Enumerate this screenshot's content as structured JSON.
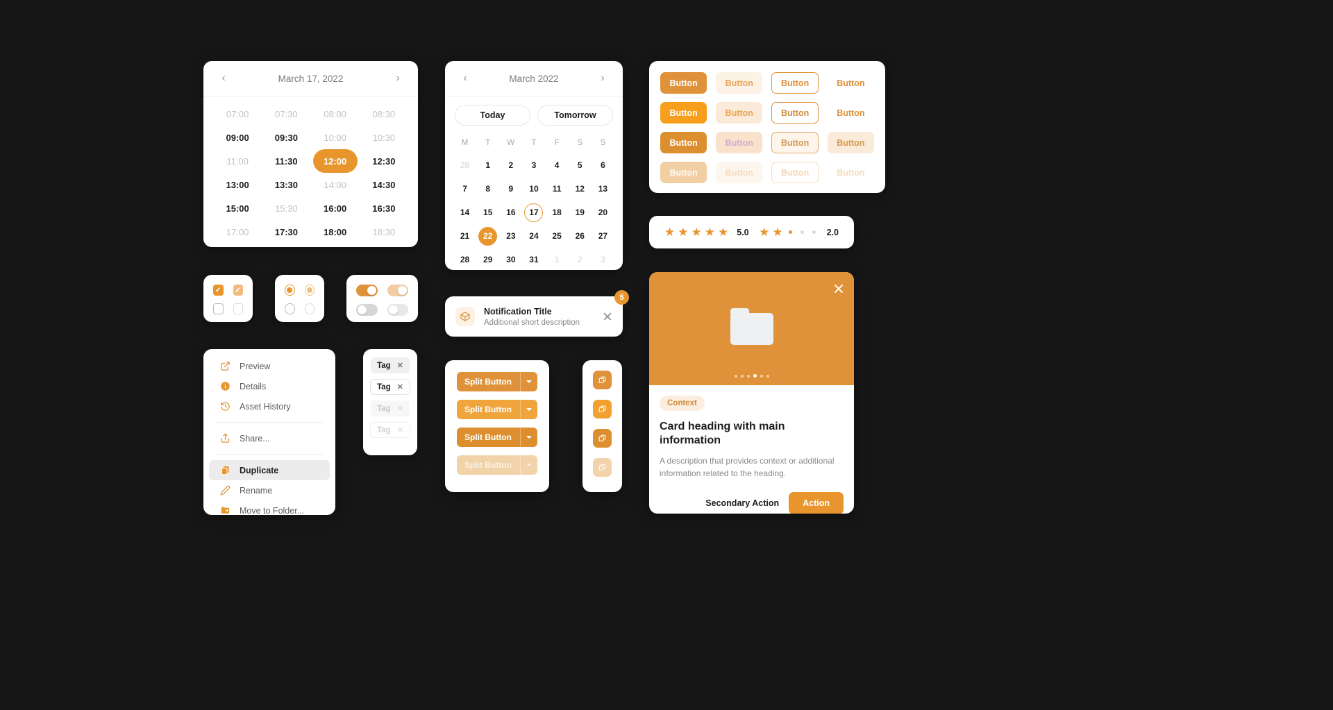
{
  "time_picker": {
    "title": "March 17, 2022",
    "prev_icon": "chevron-left-icon",
    "next_icon": "chevron-right-icon",
    "slots": [
      {
        "label": "07:00",
        "state": "disabled"
      },
      {
        "label": "07:30",
        "state": "disabled"
      },
      {
        "label": "08:00",
        "state": "disabled"
      },
      {
        "label": "08:30",
        "state": "disabled"
      },
      {
        "label": "09:00",
        "state": "available"
      },
      {
        "label": "09:30",
        "state": "available"
      },
      {
        "label": "10:00",
        "state": "disabled"
      },
      {
        "label": "10:30",
        "state": "disabled"
      },
      {
        "label": "11:00",
        "state": "disabled"
      },
      {
        "label": "11:30",
        "state": "available"
      },
      {
        "label": "12:00",
        "state": "selected"
      },
      {
        "label": "12:30",
        "state": "available"
      },
      {
        "label": "13:00",
        "state": "available"
      },
      {
        "label": "13:30",
        "state": "available"
      },
      {
        "label": "14:00",
        "state": "disabled"
      },
      {
        "label": "14:30",
        "state": "available"
      },
      {
        "label": "15:00",
        "state": "available"
      },
      {
        "label": "15:30",
        "state": "disabled"
      },
      {
        "label": "16:00",
        "state": "available"
      },
      {
        "label": "16:30",
        "state": "available"
      },
      {
        "label": "17:00",
        "state": "disabled"
      },
      {
        "label": "17:30",
        "state": "available"
      },
      {
        "label": "18:00",
        "state": "available"
      },
      {
        "label": "18:30",
        "state": "disabled"
      }
    ]
  },
  "calendar": {
    "title": "March 2022",
    "prev_icon": "chevron-left-icon",
    "next_icon": "chevron-right-icon",
    "quick": [
      {
        "label": "Today"
      },
      {
        "label": "Tomorrow"
      }
    ],
    "dow": [
      "M",
      "T",
      "W",
      "T",
      "F",
      "S",
      "S"
    ],
    "days": [
      {
        "n": "28",
        "state": "outside"
      },
      {
        "n": "1",
        "state": "normal"
      },
      {
        "n": "2",
        "state": "normal"
      },
      {
        "n": "3",
        "state": "normal"
      },
      {
        "n": "4",
        "state": "normal"
      },
      {
        "n": "5",
        "state": "normal"
      },
      {
        "n": "6",
        "state": "normal"
      },
      {
        "n": "7",
        "state": "normal"
      },
      {
        "n": "8",
        "state": "normal"
      },
      {
        "n": "9",
        "state": "normal"
      },
      {
        "n": "10",
        "state": "normal"
      },
      {
        "n": "11",
        "state": "normal"
      },
      {
        "n": "12",
        "state": "normal"
      },
      {
        "n": "13",
        "state": "normal"
      },
      {
        "n": "14",
        "state": "normal"
      },
      {
        "n": "15",
        "state": "normal"
      },
      {
        "n": "16",
        "state": "normal"
      },
      {
        "n": "17",
        "state": "today"
      },
      {
        "n": "18",
        "state": "normal"
      },
      {
        "n": "19",
        "state": "normal"
      },
      {
        "n": "20",
        "state": "normal"
      },
      {
        "n": "21",
        "state": "normal"
      },
      {
        "n": "22",
        "state": "selected"
      },
      {
        "n": "23",
        "state": "normal"
      },
      {
        "n": "24",
        "state": "normal"
      },
      {
        "n": "25",
        "state": "normal"
      },
      {
        "n": "26",
        "state": "normal"
      },
      {
        "n": "27",
        "state": "normal"
      },
      {
        "n": "28",
        "state": "normal"
      },
      {
        "n": "29",
        "state": "normal"
      },
      {
        "n": "30",
        "state": "normal"
      },
      {
        "n": "31",
        "state": "normal"
      },
      {
        "n": "1",
        "state": "outside"
      },
      {
        "n": "2",
        "state": "outside"
      },
      {
        "n": "3",
        "state": "outside"
      }
    ]
  },
  "button_matrix": {
    "rows": [
      [
        {
          "label": "Button",
          "variant": "fill"
        },
        {
          "label": "Button",
          "variant": "tint"
        },
        {
          "label": "Button",
          "variant": "outline"
        },
        {
          "label": "Button",
          "variant": "ghost"
        }
      ],
      [
        {
          "label": "Button",
          "variant": "fill2"
        },
        {
          "label": "Button",
          "variant": "tint2"
        },
        {
          "label": "Button",
          "variant": "outline2"
        },
        {
          "label": "Button",
          "variant": "ghost2"
        }
      ],
      [
        {
          "label": "Button",
          "variant": "fill3"
        },
        {
          "label": "Button",
          "variant": "tint3"
        },
        {
          "label": "Button",
          "variant": "outline3"
        },
        {
          "label": "Button",
          "variant": "ghost3"
        }
      ],
      [
        {
          "label": "Button",
          "variant": "filldis"
        },
        {
          "label": "Button",
          "variant": "tintdis"
        },
        {
          "label": "Button",
          "variant": "outlinedis"
        },
        {
          "label": "Button",
          "variant": "ghostdis"
        }
      ]
    ]
  },
  "rating": {
    "left": {
      "filled": 5,
      "total": 5,
      "value": "5.0"
    },
    "right": {
      "filled": 2,
      "total": 5,
      "value": "2.0"
    }
  },
  "card": {
    "close_icon": "close-icon",
    "media_icon": "folder-icon",
    "dots_total": 6,
    "dots_active_index": 3,
    "context_label": "Context",
    "heading": "Card heading with main information",
    "description": "A description that provides context or additional information related to the heading.",
    "secondary_action": "Secondary Action",
    "primary_action": "Action"
  },
  "checkboxes": {
    "rows": [
      [
        {
          "state": "checked"
        },
        {
          "state": "checked-light"
        }
      ],
      [
        {
          "state": "unchecked"
        },
        {
          "state": "unchecked-light"
        }
      ]
    ]
  },
  "radios": {
    "rows": [
      [
        {
          "state": "selected"
        },
        {
          "state": "selected-light"
        }
      ],
      [
        {
          "state": "unselected"
        },
        {
          "state": "unselected-light"
        }
      ]
    ]
  },
  "toggles": {
    "rows": [
      [
        {
          "state": "on"
        },
        {
          "state": "on-light"
        }
      ],
      [
        {
          "state": "off"
        },
        {
          "state": "off-light"
        }
      ]
    ]
  },
  "context_menu": {
    "groups": [
      [
        {
          "label": "Preview",
          "icon": "external-link-icon"
        },
        {
          "label": "Details",
          "icon": "info-icon"
        },
        {
          "label": "Asset History",
          "icon": "history-icon"
        }
      ],
      [
        {
          "label": "Share...",
          "icon": "share-icon"
        }
      ],
      [
        {
          "label": "Duplicate",
          "icon": "duplicate-icon",
          "active": true
        },
        {
          "label": "Rename",
          "icon": "pencil-icon"
        },
        {
          "label": "Move to Folder...",
          "icon": "folder-move-icon"
        }
      ]
    ]
  },
  "tags": {
    "items": [
      {
        "label": "Tag",
        "variant": "g",
        "close_icon": "close-icon"
      },
      {
        "label": "Tag",
        "variant": "w",
        "close_icon": "close-icon"
      },
      {
        "label": "Tag",
        "variant": "d1",
        "close_icon": "close-icon"
      },
      {
        "label": "Tag",
        "variant": "d2",
        "close_icon": "close-icon"
      }
    ]
  },
  "split_buttons": {
    "items": [
      {
        "label": "Split Button",
        "variant": "v1",
        "arrow_icon": "caret-down-icon"
      },
      {
        "label": "Split Button",
        "variant": "v2",
        "arrow_icon": "caret-down-icon"
      },
      {
        "label": "Split Button",
        "variant": "v3",
        "arrow_icon": "caret-down-icon"
      },
      {
        "label": "Split Button",
        "variant": "v4",
        "arrow_icon": "caret-down-icon"
      }
    ]
  },
  "icon_buttons": {
    "items": [
      {
        "variant": "v1",
        "icon": "copy-icon"
      },
      {
        "variant": "v2",
        "icon": "copy-icon"
      },
      {
        "variant": "v3",
        "icon": "copy-icon"
      },
      {
        "variant": "v4",
        "icon": "copy-icon"
      }
    ]
  },
  "notification": {
    "icon": "package-icon",
    "title": "Notification Title",
    "description": "Additional short description",
    "close_icon": "close-icon",
    "badge_count": "5"
  },
  "colors": {
    "background": "#161616",
    "surface": "#ffffff",
    "accent": "#e8952e",
    "accent_bright": "#f2a02f",
    "accent_dark": "#dd8f2f",
    "accent_tint": "#fbeedf"
  }
}
